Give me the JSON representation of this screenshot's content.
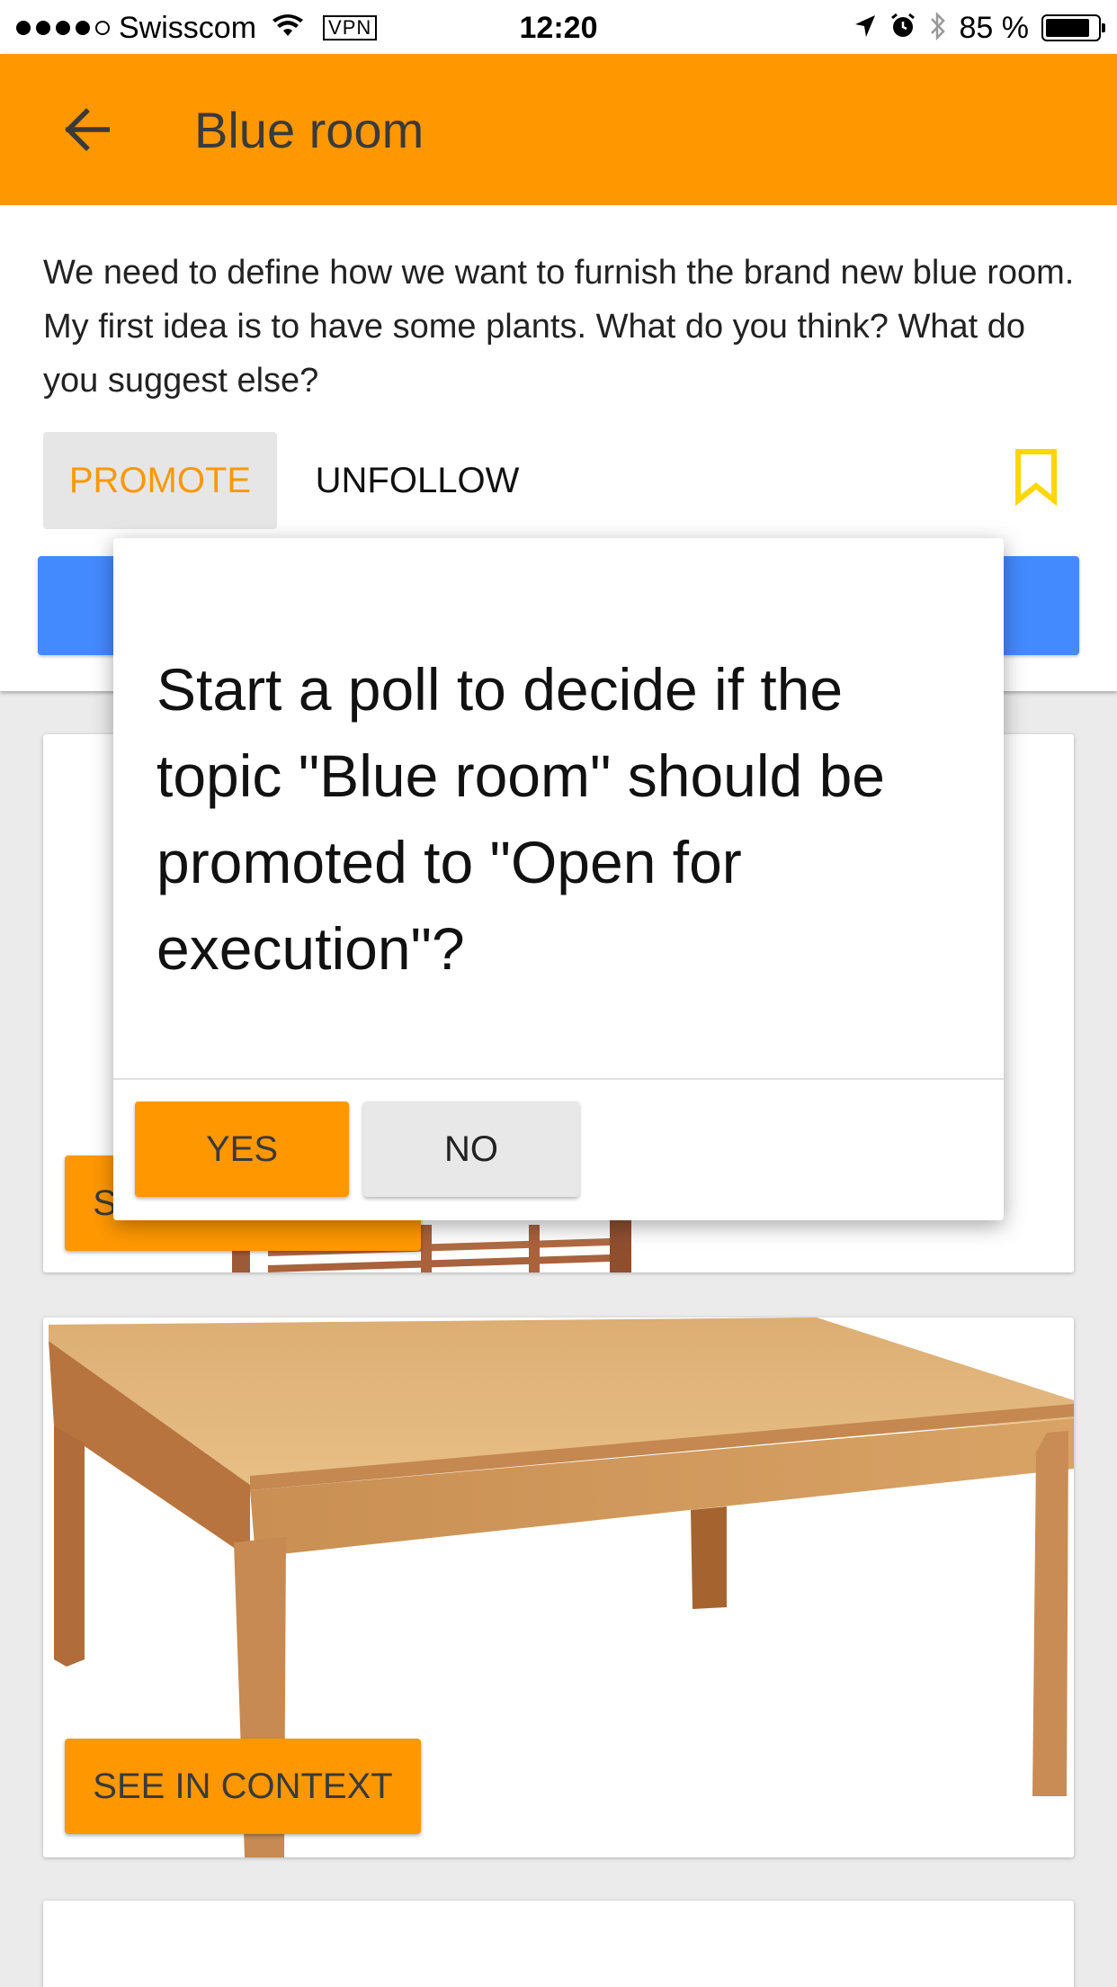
{
  "status_bar": {
    "carrier": "Swisscom",
    "vpn": "VPN",
    "time": "12:20",
    "battery": "85 %",
    "battery_level": 0.85
  },
  "app_bar": {
    "title": "Blue room",
    "back_icon": "arrow-back-icon",
    "color": "#ff9800"
  },
  "topic": {
    "description": "We need to define how we want to furnish the brand new blue room. My first idea is to have some plants. What do you think? What do you suggest else?",
    "promote_label": "PROMOTE",
    "unfollow_label": "UNFOLLOW",
    "bookmark_icon": "bookmark-icon",
    "accent_color": "#ff9800",
    "blue_button_color": "#448aff"
  },
  "cards": [
    {
      "button_label": "SEE IN CONTEXT",
      "image": "wooden-chair-image"
    },
    {
      "button_label": "SEE IN CONTEXT",
      "image": "wooden-table-image"
    },
    {
      "button_label": "",
      "image": ""
    }
  ],
  "dialog": {
    "message": "Start a poll to decide if the topic \"Blue room\" should be promoted to \"Open for execution\"?",
    "yes_label": "YES",
    "no_label": "NO"
  }
}
